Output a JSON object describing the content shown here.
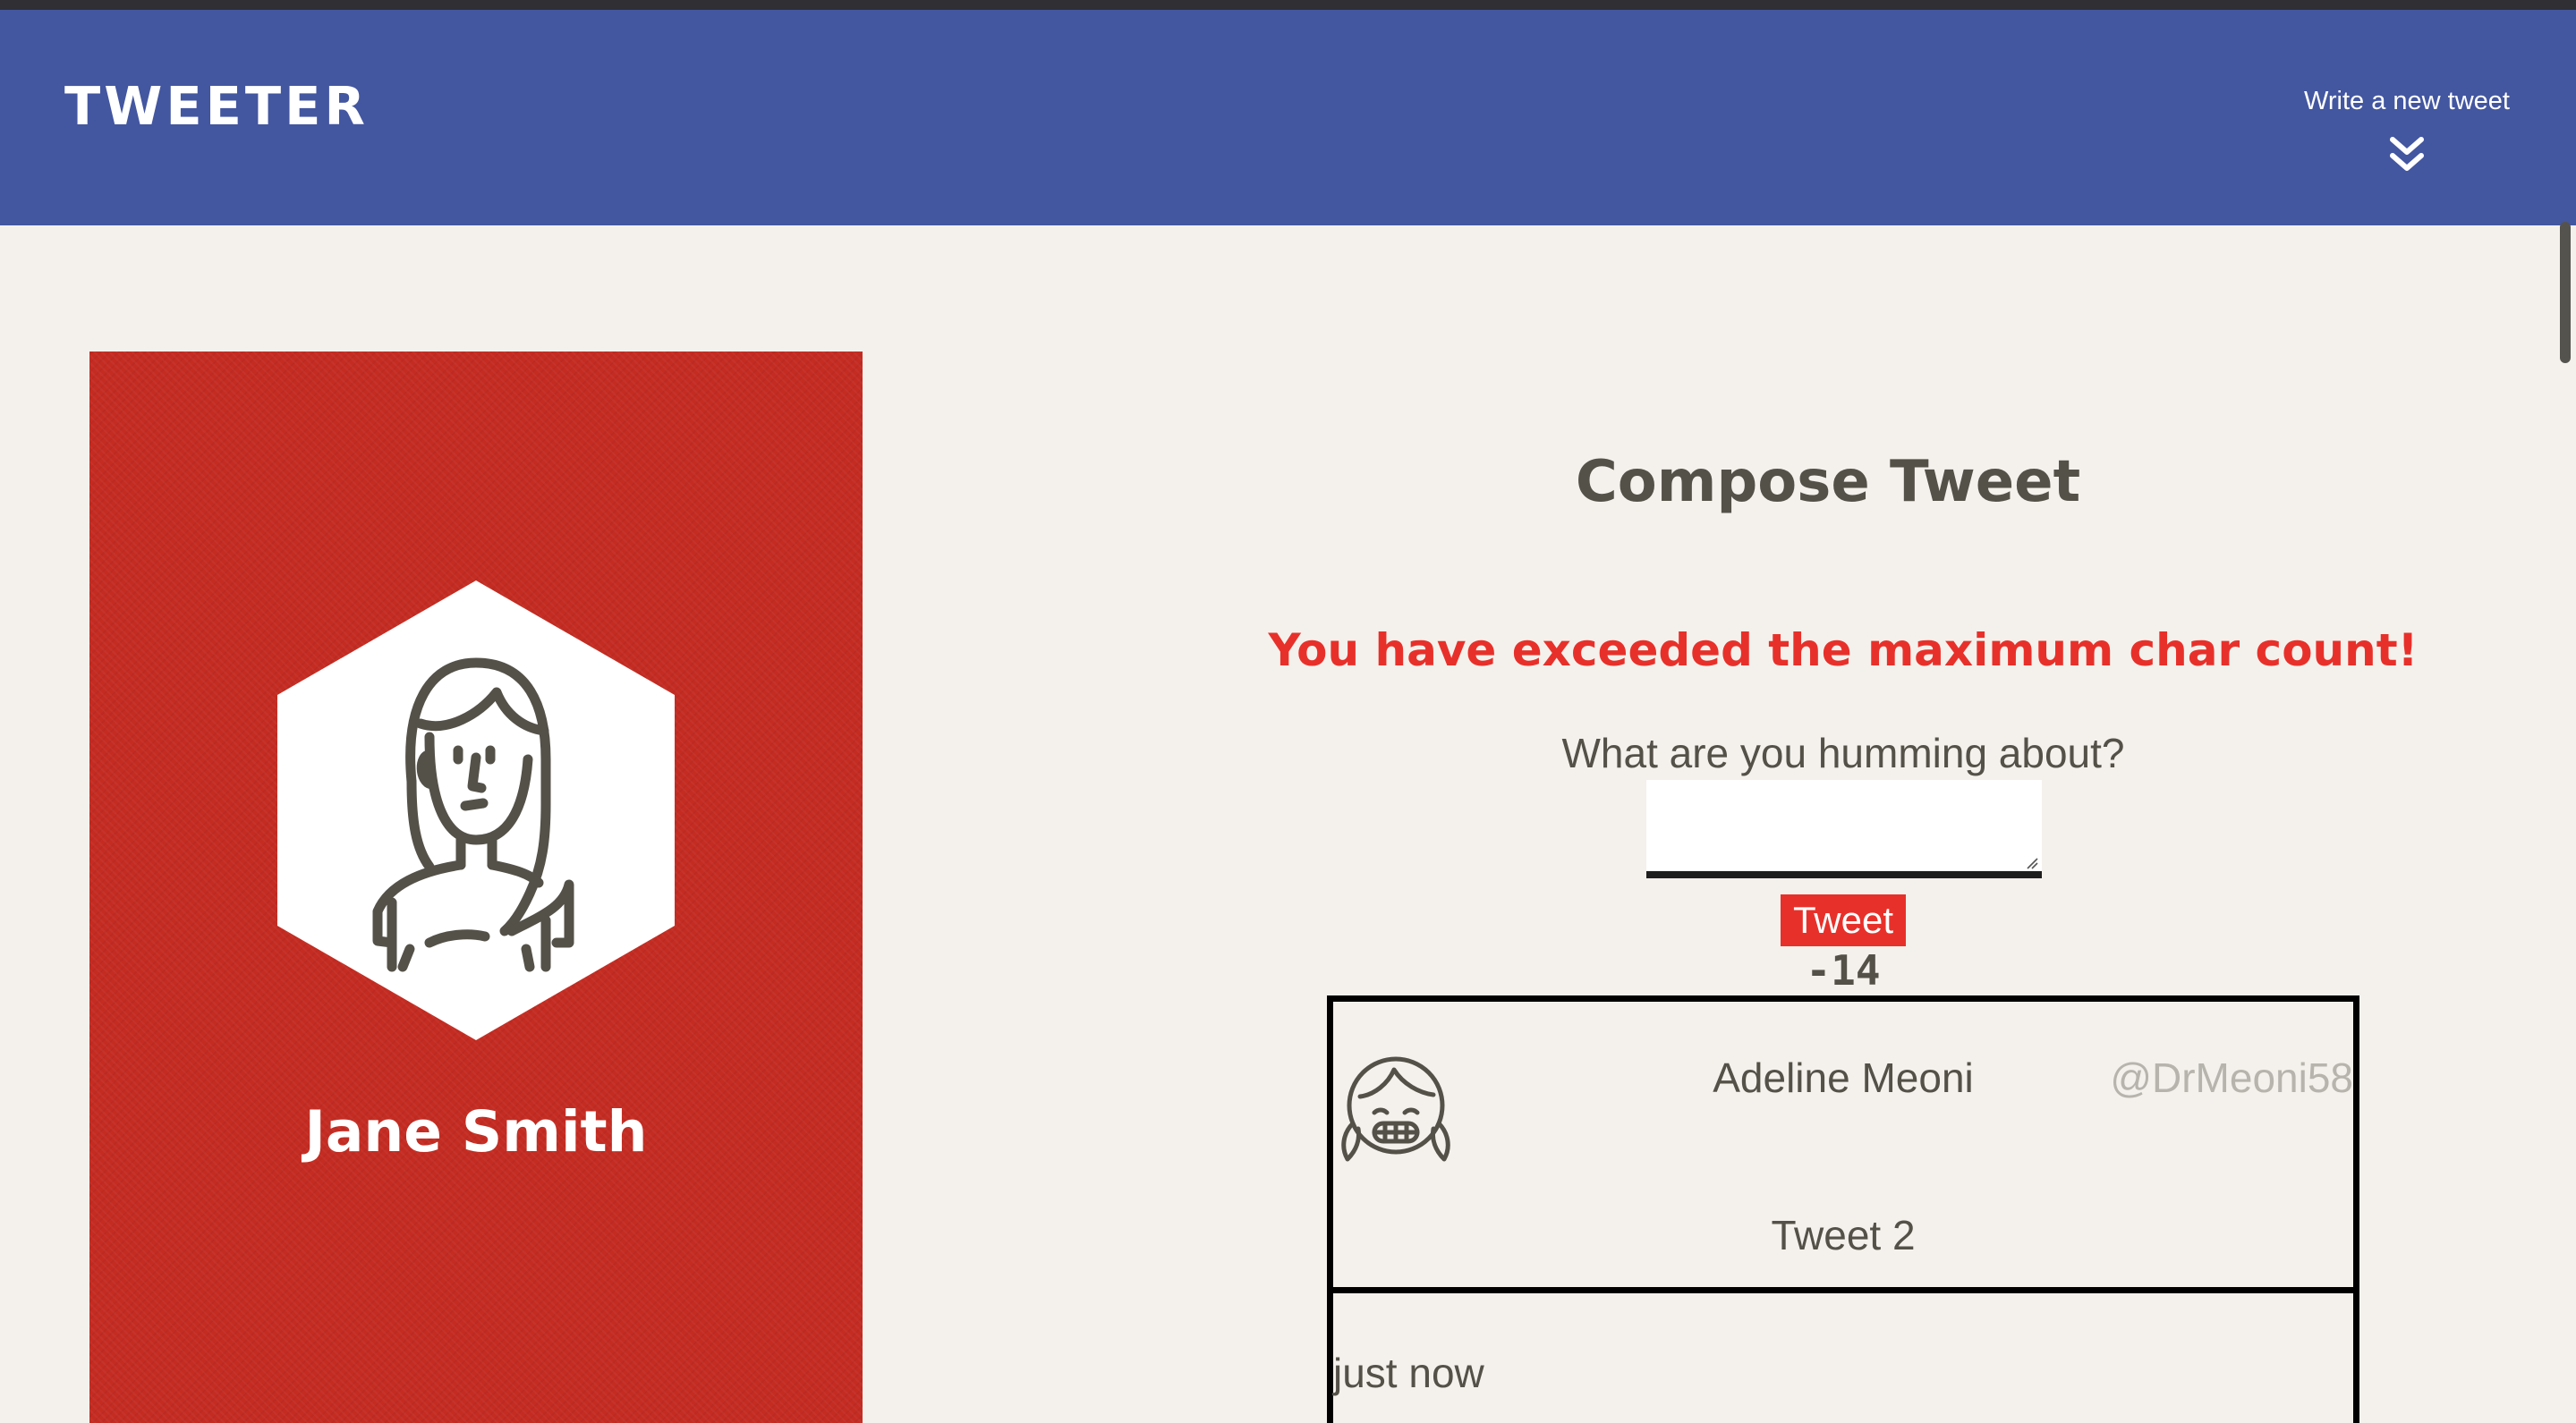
{
  "nav": {
    "brand": "TWEETER",
    "compose_link": "Write a new tweet",
    "compose_icon": "double-chevron-down-icon"
  },
  "profile": {
    "name": "Jane Smith",
    "avatar_icon": "female-user-avatar-icon"
  },
  "compose": {
    "title": "Compose Tweet",
    "error": "You have exceeded the maximum char count!",
    "prompt": "What are you humming about?",
    "text_value": "",
    "button_label": "Tweet",
    "counter": "-14"
  },
  "tweets": [
    {
      "author": "Adeline Meoni",
      "handle": "@DrMeoni58",
      "content": "Tweet 2",
      "time": "just now",
      "avatar_icon": "smiling-girl-avatar-icon"
    }
  ],
  "colors": {
    "nav_bg": "#4356a0",
    "profile_bg": "#c42c22",
    "page_bg": "#f4f1ec",
    "error": "#e8302a",
    "button": "#e8302a",
    "text": "#545149",
    "handle": "#b7b4ae"
  }
}
